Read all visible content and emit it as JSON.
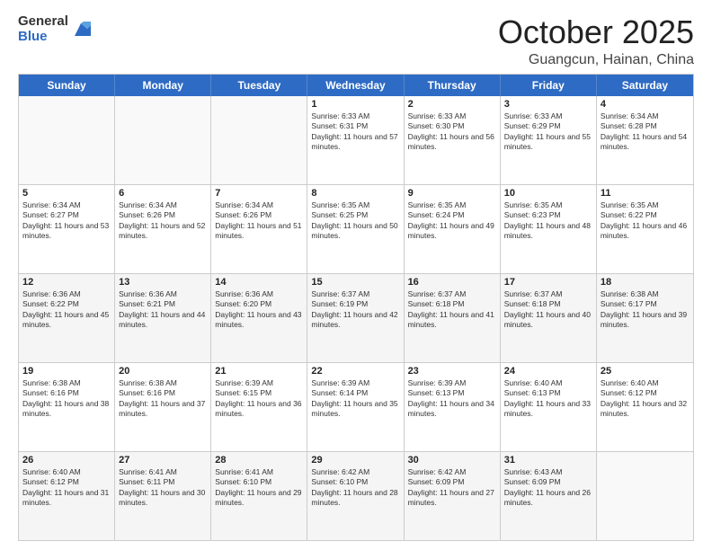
{
  "header": {
    "logo_general": "General",
    "logo_blue": "Blue",
    "month_title": "October 2025",
    "location": "Guangcun, Hainan, China"
  },
  "calendar": {
    "days_of_week": [
      "Sunday",
      "Monday",
      "Tuesday",
      "Wednesday",
      "Thursday",
      "Friday",
      "Saturday"
    ],
    "weeks": [
      [
        {
          "day": "",
          "empty": true
        },
        {
          "day": "",
          "empty": true
        },
        {
          "day": "",
          "empty": true
        },
        {
          "day": "1",
          "sunrise": "6:33 AM",
          "sunset": "6:31 PM",
          "daylight": "11 hours and 57 minutes."
        },
        {
          "day": "2",
          "sunrise": "6:33 AM",
          "sunset": "6:30 PM",
          "daylight": "11 hours and 56 minutes."
        },
        {
          "day": "3",
          "sunrise": "6:33 AM",
          "sunset": "6:29 PM",
          "daylight": "11 hours and 55 minutes."
        },
        {
          "day": "4",
          "sunrise": "6:34 AM",
          "sunset": "6:28 PM",
          "daylight": "11 hours and 54 minutes."
        }
      ],
      [
        {
          "day": "5",
          "sunrise": "6:34 AM",
          "sunset": "6:27 PM",
          "daylight": "11 hours and 53 minutes."
        },
        {
          "day": "6",
          "sunrise": "6:34 AM",
          "sunset": "6:26 PM",
          "daylight": "11 hours and 52 minutes."
        },
        {
          "day": "7",
          "sunrise": "6:34 AM",
          "sunset": "6:26 PM",
          "daylight": "11 hours and 51 minutes."
        },
        {
          "day": "8",
          "sunrise": "6:35 AM",
          "sunset": "6:25 PM",
          "daylight": "11 hours and 50 minutes."
        },
        {
          "day": "9",
          "sunrise": "6:35 AM",
          "sunset": "6:24 PM",
          "daylight": "11 hours and 49 minutes."
        },
        {
          "day": "10",
          "sunrise": "6:35 AM",
          "sunset": "6:23 PM",
          "daylight": "11 hours and 48 minutes."
        },
        {
          "day": "11",
          "sunrise": "6:35 AM",
          "sunset": "6:22 PM",
          "daylight": "11 hours and 46 minutes."
        }
      ],
      [
        {
          "day": "12",
          "sunrise": "6:36 AM",
          "sunset": "6:22 PM",
          "daylight": "11 hours and 45 minutes."
        },
        {
          "day": "13",
          "sunrise": "6:36 AM",
          "sunset": "6:21 PM",
          "daylight": "11 hours and 44 minutes."
        },
        {
          "day": "14",
          "sunrise": "6:36 AM",
          "sunset": "6:20 PM",
          "daylight": "11 hours and 43 minutes."
        },
        {
          "day": "15",
          "sunrise": "6:37 AM",
          "sunset": "6:19 PM",
          "daylight": "11 hours and 42 minutes."
        },
        {
          "day": "16",
          "sunrise": "6:37 AM",
          "sunset": "6:18 PM",
          "daylight": "11 hours and 41 minutes."
        },
        {
          "day": "17",
          "sunrise": "6:37 AM",
          "sunset": "6:18 PM",
          "daylight": "11 hours and 40 minutes."
        },
        {
          "day": "18",
          "sunrise": "6:38 AM",
          "sunset": "6:17 PM",
          "daylight": "11 hours and 39 minutes."
        }
      ],
      [
        {
          "day": "19",
          "sunrise": "6:38 AM",
          "sunset": "6:16 PM",
          "daylight": "11 hours and 38 minutes."
        },
        {
          "day": "20",
          "sunrise": "6:38 AM",
          "sunset": "6:16 PM",
          "daylight": "11 hours and 37 minutes."
        },
        {
          "day": "21",
          "sunrise": "6:39 AM",
          "sunset": "6:15 PM",
          "daylight": "11 hours and 36 minutes."
        },
        {
          "day": "22",
          "sunrise": "6:39 AM",
          "sunset": "6:14 PM",
          "daylight": "11 hours and 35 minutes."
        },
        {
          "day": "23",
          "sunrise": "6:39 AM",
          "sunset": "6:13 PM",
          "daylight": "11 hours and 34 minutes."
        },
        {
          "day": "24",
          "sunrise": "6:40 AM",
          "sunset": "6:13 PM",
          "daylight": "11 hours and 33 minutes."
        },
        {
          "day": "25",
          "sunrise": "6:40 AM",
          "sunset": "6:12 PM",
          "daylight": "11 hours and 32 minutes."
        }
      ],
      [
        {
          "day": "26",
          "sunrise": "6:40 AM",
          "sunset": "6:12 PM",
          "daylight": "11 hours and 31 minutes."
        },
        {
          "day": "27",
          "sunrise": "6:41 AM",
          "sunset": "6:11 PM",
          "daylight": "11 hours and 30 minutes."
        },
        {
          "day": "28",
          "sunrise": "6:41 AM",
          "sunset": "6:10 PM",
          "daylight": "11 hours and 29 minutes."
        },
        {
          "day": "29",
          "sunrise": "6:42 AM",
          "sunset": "6:10 PM",
          "daylight": "11 hours and 28 minutes."
        },
        {
          "day": "30",
          "sunrise": "6:42 AM",
          "sunset": "6:09 PM",
          "daylight": "11 hours and 27 minutes."
        },
        {
          "day": "31",
          "sunrise": "6:43 AM",
          "sunset": "6:09 PM",
          "daylight": "11 hours and 26 minutes."
        },
        {
          "day": "",
          "empty": true
        }
      ]
    ]
  }
}
